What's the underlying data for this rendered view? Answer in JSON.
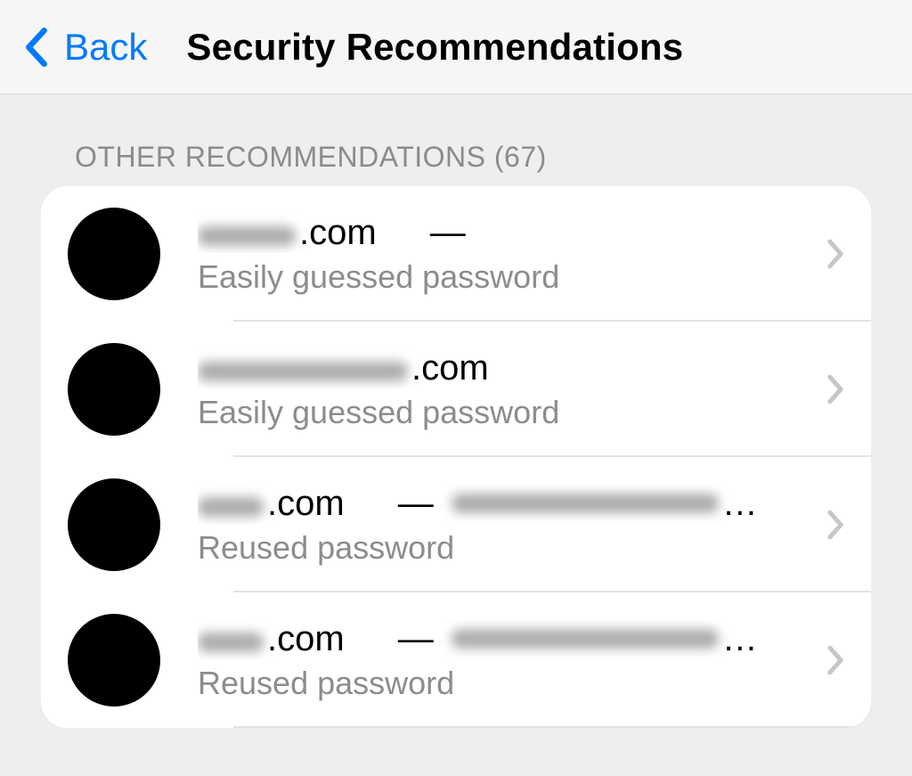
{
  "nav": {
    "back_label": "Back",
    "title": "Security Recommendations"
  },
  "section": {
    "header": "OTHER RECOMMENDATIONS (67)",
    "count": 67
  },
  "rows": [
    {
      "domain_redacted_width": 110,
      "domain_suffix": ".com",
      "dash": "—",
      "account_redacted_width": 0,
      "show_ellipsis": false,
      "sub": "Easily guessed password"
    },
    {
      "domain_redacted_width": 236,
      "domain_suffix": ".com",
      "dash": "",
      "account_redacted_width": 0,
      "show_ellipsis": false,
      "sub": "Easily guessed password"
    },
    {
      "domain_redacted_width": 74,
      "domain_suffix": ".com",
      "dash": "—",
      "account_redacted_width": 300,
      "show_ellipsis": true,
      "sub": "Reused password"
    },
    {
      "domain_redacted_width": 74,
      "domain_suffix": ".com",
      "dash": "—",
      "account_redacted_width": 300,
      "show_ellipsis": true,
      "sub": "Reused password"
    }
  ]
}
